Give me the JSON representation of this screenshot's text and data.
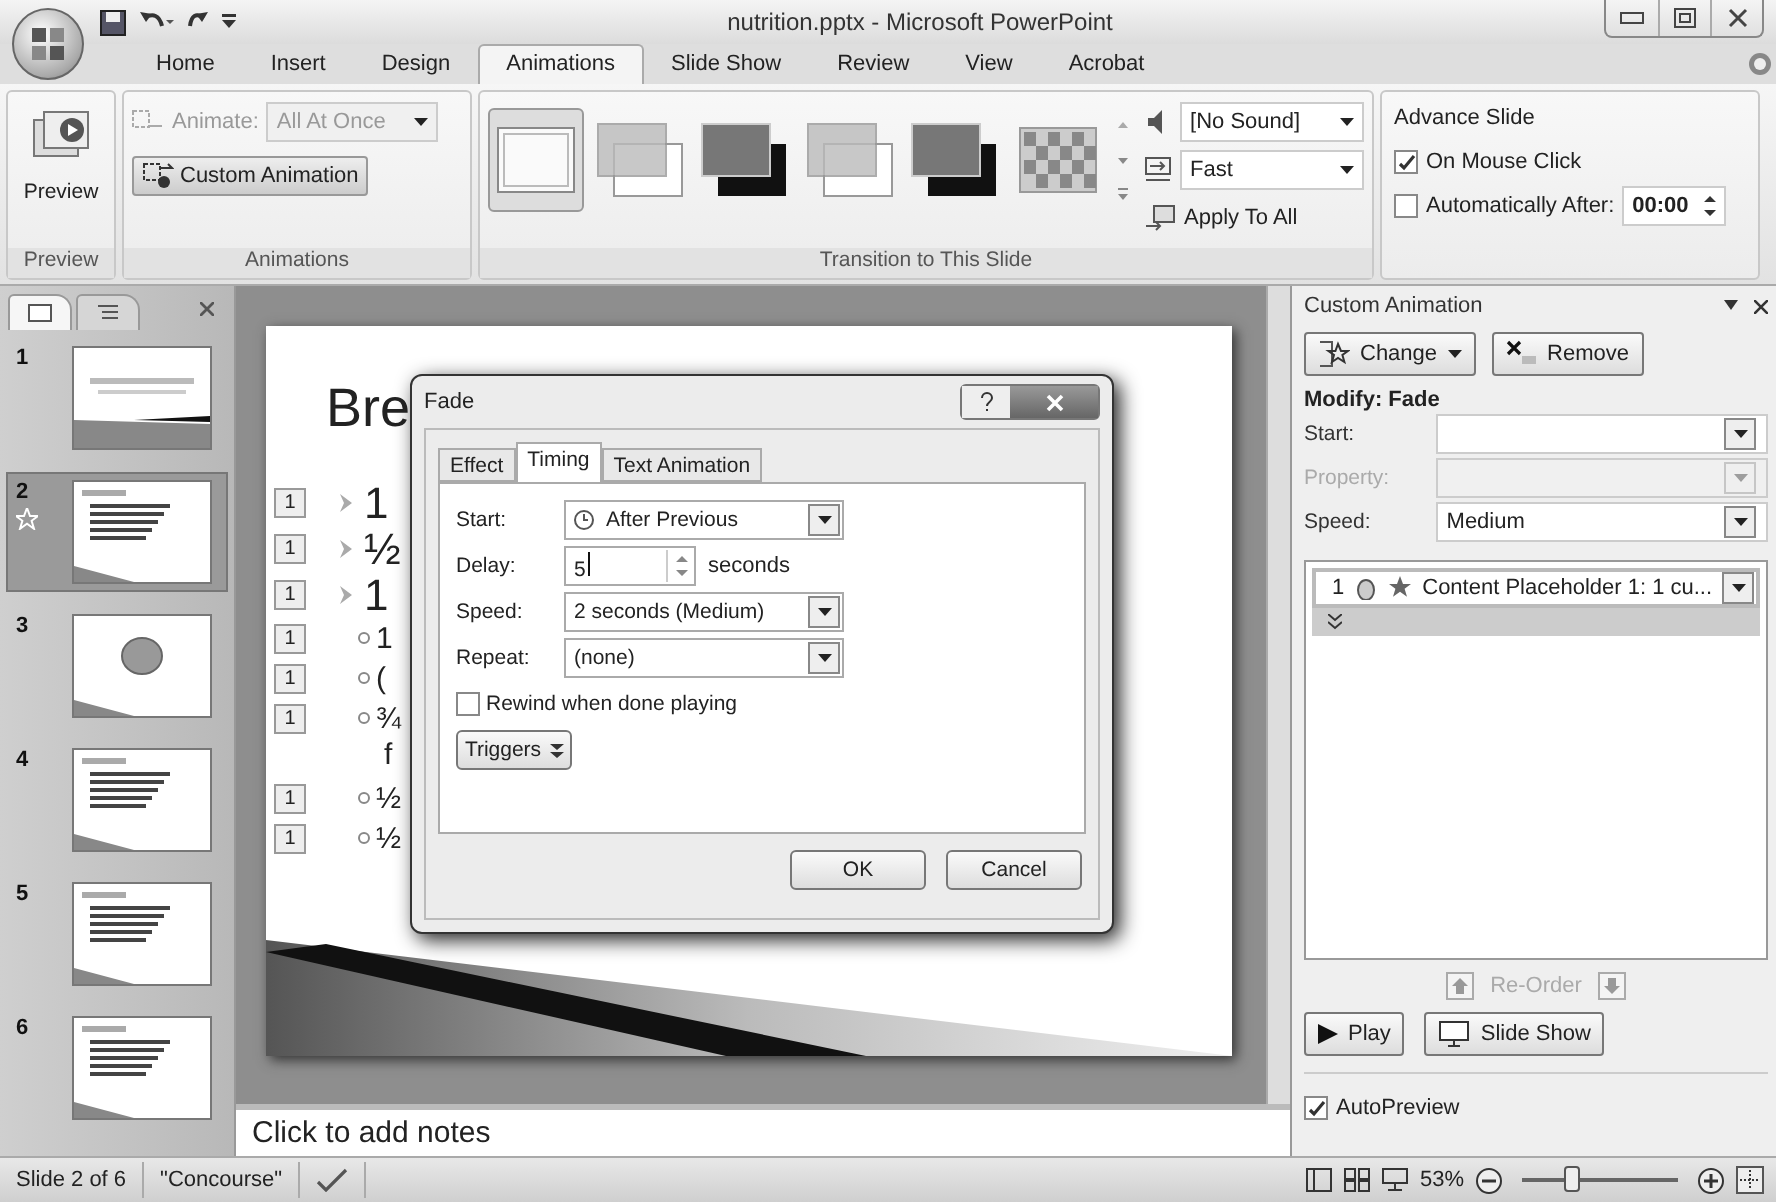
{
  "window": {
    "title": "nutrition.pptx - Microsoft PowerPoint"
  },
  "tabs": [
    {
      "label": "Home",
      "selected": false
    },
    {
      "label": "Insert",
      "selected": false
    },
    {
      "label": "Design",
      "selected": false
    },
    {
      "label": "Animations",
      "selected": true
    },
    {
      "label": "Slide Show",
      "selected": false
    },
    {
      "label": "Review",
      "selected": false
    },
    {
      "label": "View",
      "selected": false
    },
    {
      "label": "Acrobat",
      "selected": false
    }
  ],
  "ribbon": {
    "preview_group": {
      "button": "Preview",
      "label": "Preview"
    },
    "animations_group": {
      "animate_label": "Animate:",
      "animate_value": "All At Once",
      "custom_animation": "Custom Animation",
      "label": "Animations"
    },
    "transition_group": {
      "transitions": [
        {
          "kind": "none",
          "selected": true
        },
        {
          "kind": "fade",
          "selected": false
        },
        {
          "kind": "dark",
          "selected": false
        },
        {
          "kind": "fade",
          "selected": false
        },
        {
          "kind": "dark",
          "selected": false
        },
        {
          "kind": "dissolve",
          "selected": false
        }
      ],
      "sound": "[No Sound]",
      "speed": "Fast",
      "apply_to_all": "Apply To All",
      "label": "Transition to This Slide"
    },
    "advance_group": {
      "title": "Advance Slide",
      "on_mouse_click": {
        "label": "On Mouse Click",
        "checked": true
      },
      "automatically_after": {
        "label": "Automatically After:",
        "checked": false,
        "value": "00:00"
      }
    }
  },
  "slides_pane": {
    "tabs": [
      {
        "kind": "slides",
        "selected": true
      },
      {
        "kind": "outline",
        "selected": false
      }
    ],
    "slides": [
      {
        "number": "1",
        "kind": "title",
        "selected": false,
        "animated": false
      },
      {
        "number": "2",
        "kind": "bullets",
        "selected": true,
        "animated": true
      },
      {
        "number": "3",
        "kind": "circle",
        "selected": false,
        "animated": false
      },
      {
        "number": "4",
        "kind": "bullets",
        "selected": false,
        "animated": false
      },
      {
        "number": "5",
        "kind": "bullets",
        "selected": false,
        "animated": false
      },
      {
        "number": "6",
        "kind": "bullets",
        "selected": false,
        "animated": false
      }
    ]
  },
  "slide": {
    "title": "Bre",
    "bullets": [
      {
        "badge": "1",
        "text": "1"
      },
      {
        "badge": "1",
        "text": "½"
      },
      {
        "badge": "1",
        "text": "1",
        "children": [
          {
            "badge": "1",
            "text": "1"
          },
          {
            "badge": "1",
            "text": "("
          },
          {
            "badge": "1",
            "text": "¾",
            "continuation": "f"
          },
          {
            "badge": "1",
            "text": "½"
          },
          {
            "badge": "1",
            "text": "½"
          }
        ]
      }
    ]
  },
  "dialog": {
    "title": "Fade",
    "tabs": [
      {
        "label": "Effect",
        "selected": false
      },
      {
        "label": "Timing",
        "selected": true
      },
      {
        "label": "Text Animation",
        "selected": false
      }
    ],
    "start": {
      "label": "Start:",
      "value": "After Previous"
    },
    "delay": {
      "label": "Delay:",
      "value": "5",
      "unit": "seconds"
    },
    "speed": {
      "label": "Speed:",
      "value": "2 seconds (Medium)"
    },
    "repeat": {
      "label": "Repeat:",
      "value": "(none)"
    },
    "rewind": {
      "label": "Rewind when done playing",
      "checked": false
    },
    "triggers": "Triggers",
    "ok": "OK",
    "cancel": "Cancel"
  },
  "notes": {
    "placeholder": "Click to add notes"
  },
  "task_pane": {
    "title": "Custom Animation",
    "change": "Change",
    "remove": "Remove",
    "modify": "Modify: Fade",
    "start": {
      "label": "Start:",
      "disabled": false
    },
    "property": {
      "label": "Property:",
      "disabled": true
    },
    "speed": {
      "label": "Speed:",
      "value": "Medium",
      "disabled": false
    },
    "items": [
      {
        "number": "1",
        "text": "Content Placeholder 1: 1 cu...",
        "selected": true
      }
    ],
    "reorder": {
      "label": "Re-Order",
      "disabled": true
    },
    "play": "Play",
    "slide_show": "Slide Show",
    "autopreview": {
      "label": "AutoPreview",
      "checked": true
    }
  },
  "status_bar": {
    "slide": "Slide 2 of 6",
    "theme": "\"Concourse\"",
    "zoom": "53%",
    "zoom_level": {
      "level": 0.3
    }
  }
}
